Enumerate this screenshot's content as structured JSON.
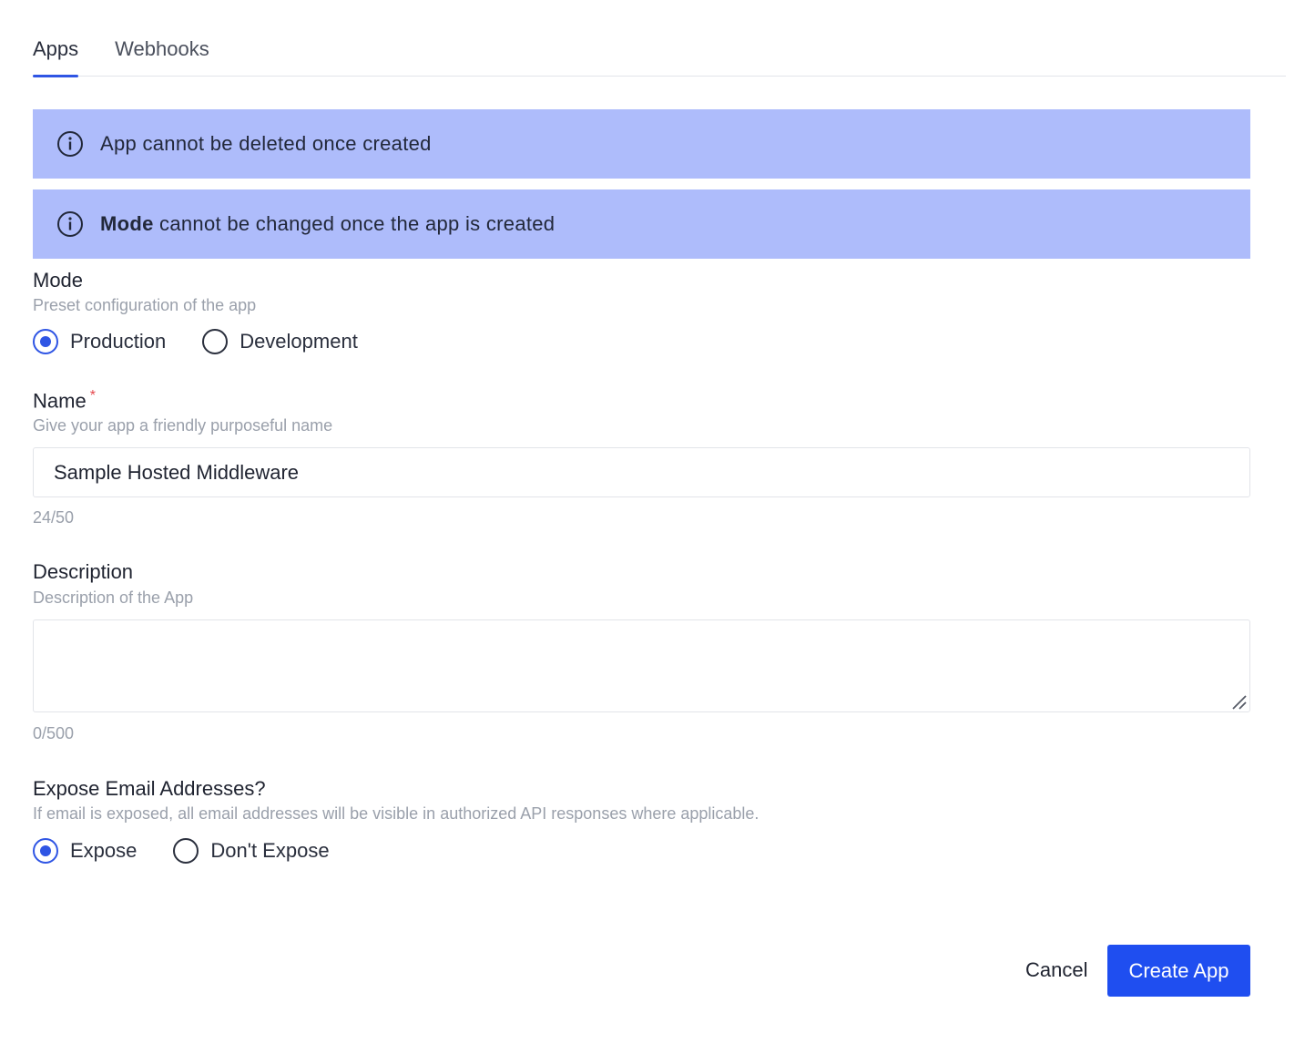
{
  "tabs": [
    {
      "label": "Apps",
      "active": true
    },
    {
      "label": "Webhooks",
      "active": false
    }
  ],
  "banners": {
    "delete_notice": "App cannot be deleted once created",
    "mode_notice_bold": "Mode",
    "mode_notice_rest": " cannot be changed once the app is created"
  },
  "mode": {
    "title": "Mode",
    "subtitle": "Preset configuration of the app",
    "options": [
      "Production",
      "Development"
    ],
    "selected": "Production"
  },
  "name": {
    "title": "Name",
    "required_mark": "*",
    "subtitle": "Give your app a friendly purposeful name",
    "value": "Sample Hosted Middleware",
    "counter": "24/50"
  },
  "description": {
    "title": "Description",
    "subtitle": "Description of the App",
    "value": "",
    "counter": "0/500"
  },
  "expose_email": {
    "title": "Expose Email Addresses?",
    "subtitle": "If email is exposed, all email addresses will be visible in authorized API responses where applicable.",
    "options": [
      "Expose",
      "Don't Expose"
    ],
    "selected": "Expose"
  },
  "actions": {
    "cancel_label": "Cancel",
    "create_label": "Create App"
  },
  "colors": {
    "accent": "#1f4ef0",
    "banner_bg": "#aebcfb",
    "required": "#e5484d"
  }
}
